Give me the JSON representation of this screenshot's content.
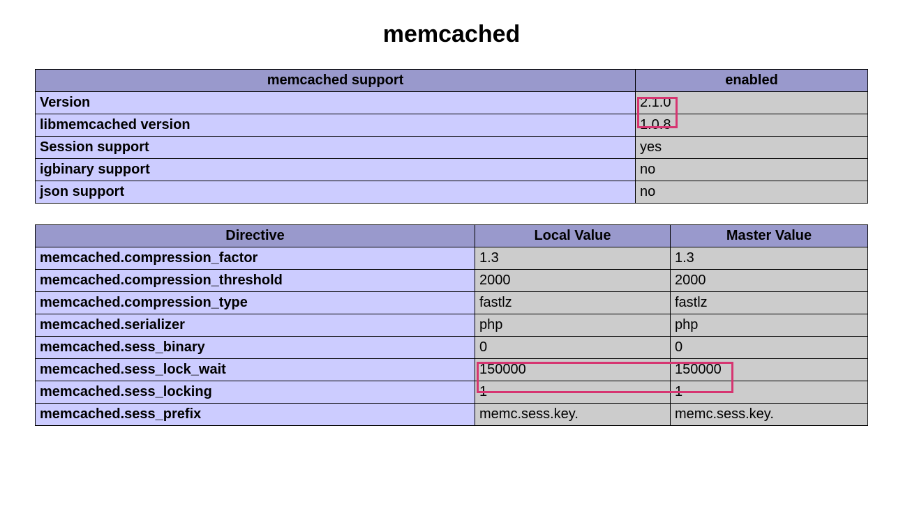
{
  "title": "memcached",
  "supportTable": {
    "headers": {
      "left": "memcached support",
      "right": "enabled"
    },
    "rows": [
      {
        "label": "Version",
        "value": "2.1.0"
      },
      {
        "label": "libmemcached version",
        "value": "1.0.8"
      },
      {
        "label": "Session support",
        "value": "yes"
      },
      {
        "label": "igbinary support",
        "value": "no"
      },
      {
        "label": "json support",
        "value": "no"
      }
    ]
  },
  "directiveTable": {
    "headers": {
      "directive": "Directive",
      "local": "Local Value",
      "master": "Master Value"
    },
    "rows": [
      {
        "directive": "memcached.compression_factor",
        "local": "1.3",
        "master": "1.3"
      },
      {
        "directive": "memcached.compression_threshold",
        "local": "2000",
        "master": "2000"
      },
      {
        "directive": "memcached.compression_type",
        "local": "fastlz",
        "master": "fastlz"
      },
      {
        "directive": "memcached.serializer",
        "local": "php",
        "master": "php"
      },
      {
        "directive": "memcached.sess_binary",
        "local": "0",
        "master": "0"
      },
      {
        "directive": "memcached.sess_lock_wait",
        "local": "150000",
        "master": "150000"
      },
      {
        "directive": "memcached.sess_locking",
        "local": "1",
        "master": "1"
      },
      {
        "directive": "memcached.sess_prefix",
        "local": "memc.sess.key.",
        "master": "memc.sess.key."
      }
    ]
  }
}
